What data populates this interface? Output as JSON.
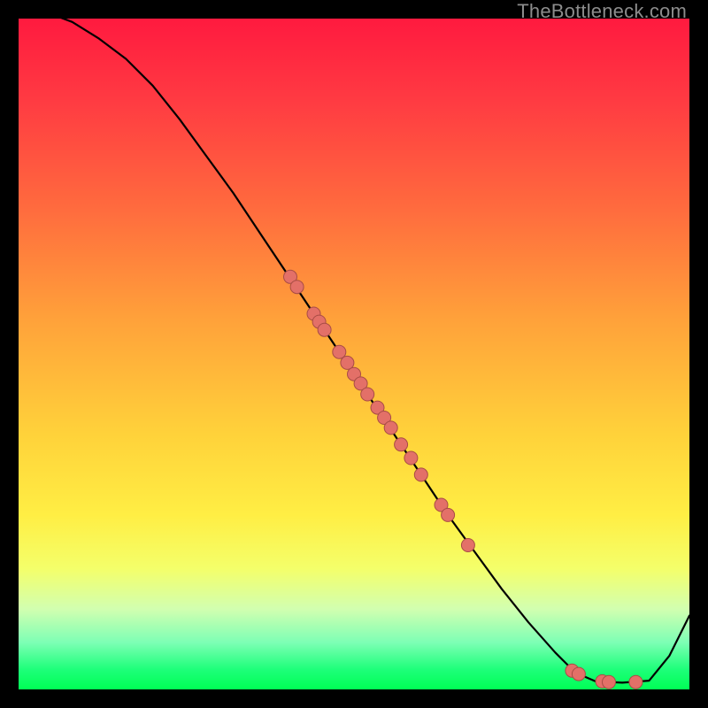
{
  "watermark": "TheBottleneck.com",
  "colors": {
    "dot_fill": "#e37068",
    "dot_stroke": "#a84c45",
    "curve": "#000000"
  },
  "chart_data": {
    "type": "line",
    "title": "",
    "xlabel": "",
    "ylabel": "",
    "xlim": [
      0,
      100
    ],
    "ylim": [
      0,
      100
    ],
    "grid": false,
    "series": [
      {
        "name": "curve",
        "x": [
          0,
          4,
          8,
          12,
          16,
          20,
          24,
          28,
          32,
          36,
          40,
          44,
          48,
          52,
          56,
          60,
          64,
          68,
          72,
          76,
          80,
          83,
          86,
          90,
          94,
          97,
          100
        ],
        "y": [
          102,
          101,
          99.5,
          97,
          94,
          90,
          85,
          79.5,
          74,
          68,
          62,
          56,
          50,
          44,
          38,
          32,
          26,
          20.5,
          15,
          10,
          5.5,
          2.5,
          1.2,
          1.0,
          1.3,
          5,
          11
        ]
      }
    ],
    "scatter": {
      "name": "highlight-points",
      "points": [
        {
          "x": 40.5,
          "y": 61.5
        },
        {
          "x": 41.5,
          "y": 60.0
        },
        {
          "x": 44.0,
          "y": 56.0
        },
        {
          "x": 44.8,
          "y": 54.8
        },
        {
          "x": 45.6,
          "y": 53.6
        },
        {
          "x": 47.8,
          "y": 50.3
        },
        {
          "x": 49.0,
          "y": 48.7
        },
        {
          "x": 50.0,
          "y": 47.0
        },
        {
          "x": 51.0,
          "y": 45.6
        },
        {
          "x": 52.0,
          "y": 44.0
        },
        {
          "x": 53.5,
          "y": 42.0
        },
        {
          "x": 54.5,
          "y": 40.5
        },
        {
          "x": 55.5,
          "y": 39.0
        },
        {
          "x": 57.0,
          "y": 36.5
        },
        {
          "x": 58.5,
          "y": 34.5
        },
        {
          "x": 60.0,
          "y": 32.0
        },
        {
          "x": 63.0,
          "y": 27.5
        },
        {
          "x": 64.0,
          "y": 26.0
        },
        {
          "x": 67.0,
          "y": 21.5
        },
        {
          "x": 82.5,
          "y": 2.8
        },
        {
          "x": 83.5,
          "y": 2.3
        },
        {
          "x": 87.0,
          "y": 1.2
        },
        {
          "x": 88.0,
          "y": 1.1
        },
        {
          "x": 92.0,
          "y": 1.1
        }
      ]
    }
  }
}
